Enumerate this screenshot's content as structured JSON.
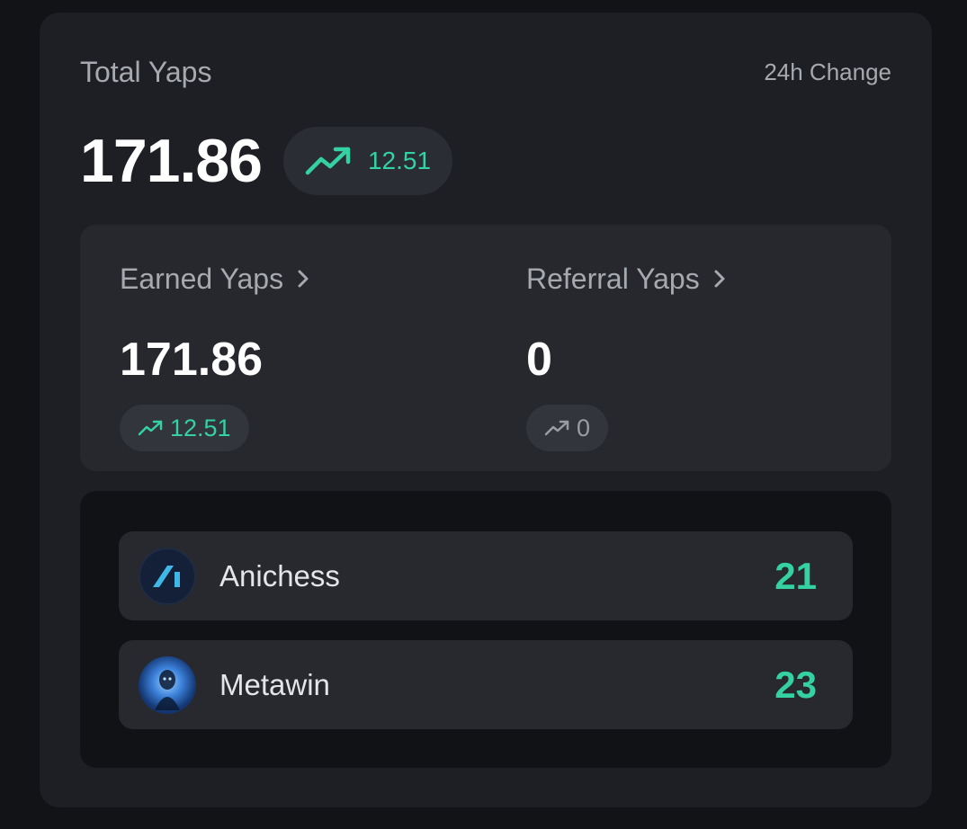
{
  "summary": {
    "total_label": "Total Yaps",
    "change_label": "24h Change",
    "total_value": "171.86",
    "total_change": "12.51"
  },
  "breakdown": {
    "earned": {
      "label": "Earned Yaps",
      "value": "171.86",
      "change": "12.51"
    },
    "referral": {
      "label": "Referral Yaps",
      "value": "0",
      "change": "0"
    }
  },
  "projects": [
    {
      "name": "Anichess",
      "score": "21",
      "icon": "anichess-logo"
    },
    {
      "name": "Metawin",
      "score": "23",
      "icon": "metawin-logo"
    }
  ],
  "colors": {
    "accent_green": "#34d1a3",
    "card_bg": "#1d1f25",
    "page_bg": "#121317"
  },
  "icons": {
    "trend": "trending-up-icon",
    "chevron": "chevron-right-icon"
  }
}
